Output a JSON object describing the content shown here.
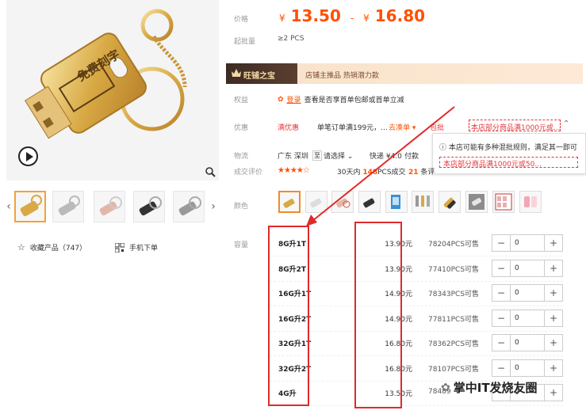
{
  "gallery": {
    "engraving_text": "免费刻字",
    "favorite_label": "收藏产品（747）",
    "mobile_label": "手机下单"
  },
  "price": {
    "label": "价格",
    "currency": "¥",
    "low": "13.50",
    "separator": "-",
    "high": "16.80"
  },
  "min_order": {
    "label": "起批量",
    "value": "≥2 PCS"
  },
  "banner": {
    "title": "旺铺之宝",
    "subtitle": "店铺主推品  热销潜力款"
  },
  "benefits": {
    "label": "权益",
    "login": "登录",
    "text": "查看是否享首单包邮或首单立减"
  },
  "promo": {
    "label": "优惠",
    "badge": "满优惠",
    "text": "单笔订单满199元，...",
    "toggle": "去凑单 ▾",
    "coupon_label": "包批",
    "coupon_tag": "本店部分商品满1000元或...",
    "popup_line1": "本店可能有多种混批规则，满足其一即可",
    "popup_line2": "本店部分商品满1000元或50..."
  },
  "logistics": {
    "label": "物流",
    "origin": "广东 深圳",
    "to": "至",
    "select": "请选择",
    "express": "快递 ¥4.0",
    "pay": "付款"
  },
  "reviews": {
    "label": "成交评价",
    "stars": "★★★★☆",
    "days": "30天内",
    "count": "148",
    "deals_suffix": "PCS成交",
    "reviews_count": "21",
    "reviews_suffix": "条评"
  },
  "color_label": "颜色",
  "capacity_label": "容量",
  "skus": [
    {
      "name": "8G升1T",
      "price": "13.90元",
      "stock": "78204PCS可售",
      "qty": "0"
    },
    {
      "name": "8G升2T",
      "price": "13.90元",
      "stock": "77410PCS可售",
      "qty": "0"
    },
    {
      "name": "16G升1T",
      "price": "14.90元",
      "stock": "78343PCS可售",
      "qty": "0"
    },
    {
      "name": "16G升2T",
      "price": "14.90元",
      "stock": "77811PCS可售",
      "qty": "0"
    },
    {
      "name": "32G升1T",
      "price": "16.80元",
      "stock": "78362PCS可售",
      "qty": "0"
    },
    {
      "name": "32G升2T",
      "price": "16.80元",
      "stock": "78107PCS可售",
      "qty": "0"
    },
    {
      "name": "4G升",
      "price": "13.50元",
      "stock": "78489",
      "qty": "0"
    }
  ],
  "watermark": "掌中IT发烧友圈",
  "colors": {
    "accent": "#ff5000",
    "annotation": "#e02a2a",
    "selected": "#f08c28"
  }
}
